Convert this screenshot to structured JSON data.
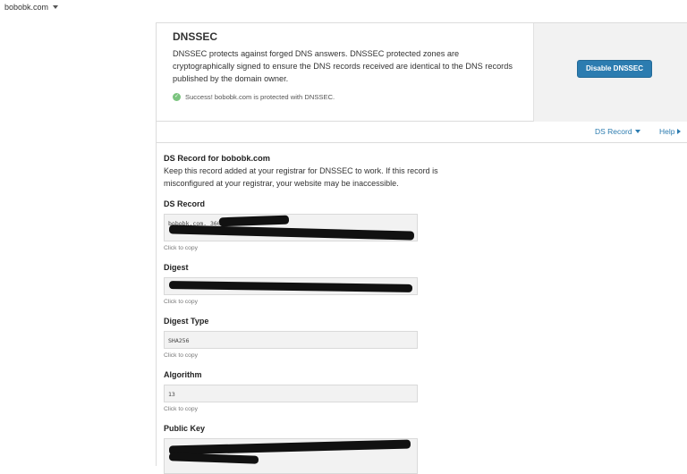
{
  "topbar": {
    "domain": "bobobk.com"
  },
  "dnssec": {
    "title": "DNSSEC",
    "description": "DNSSEC protects against forged DNS answers. DNSSEC protected zones are cryptographically signed to ensure the DNS records received are identical to the DNS records published by the domain owner.",
    "success_text": "Success! bobobk.com is protected with DNSSEC.",
    "disable_button": "Disable DNSSEC",
    "colors": {
      "button": "#2c7cb0",
      "success": "#7bc47f",
      "link": "#2c7cb0"
    }
  },
  "tabs": {
    "ds_record": "DS Record",
    "help": "Help"
  },
  "ds": {
    "title": "DS Record for bobobk.com",
    "description": "Keep this record added at your registrar for DNSSEC to work. If this record is misconfigured at your registrar, your website may be inaccessible.",
    "copy_hint": "Click to copy",
    "fields": {
      "ds_record": {
        "label": "DS Record",
        "value": "bobobk.com. 3600 IN DS"
      },
      "digest": {
        "label": "Digest",
        "value": ""
      },
      "digest_type": {
        "label": "Digest Type",
        "value": "SHA256"
      },
      "algorithm": {
        "label": "Algorithm",
        "value": "13"
      },
      "public_key": {
        "label": "Public Key",
        "value": ""
      }
    }
  }
}
